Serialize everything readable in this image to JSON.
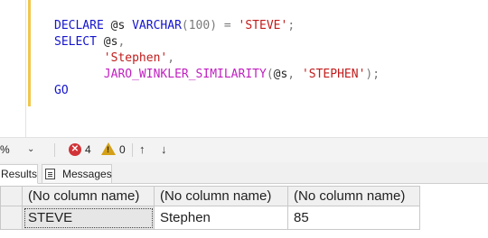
{
  "editor": {
    "lines": [
      [
        {
          "t": "DECLARE",
          "c": "kw"
        },
        {
          "t": " @s ",
          "c": "tx"
        },
        {
          "t": "VARCHAR",
          "c": "kw"
        },
        {
          "t": "(100)",
          "c": "gr"
        },
        {
          "t": " = ",
          "c": "gr"
        },
        {
          "t": "'STEVE'",
          "c": "str"
        },
        {
          "t": ";",
          "c": "gr"
        }
      ],
      [
        {
          "t": "SELECT",
          "c": "kw"
        },
        {
          "t": " @s",
          "c": "tx"
        },
        {
          "t": ",",
          "c": "gr"
        }
      ],
      [
        {
          "t": "       ",
          "c": "tx"
        },
        {
          "t": "'Stephen'",
          "c": "str"
        },
        {
          "t": ",",
          "c": "gr"
        }
      ],
      [
        {
          "t": "       ",
          "c": "tx"
        },
        {
          "t": "JARO_WINKLER_SIMILARITY",
          "c": "fn"
        },
        {
          "t": "(",
          "c": "gr"
        },
        {
          "t": "@s",
          "c": "tx"
        },
        {
          "t": ", ",
          "c": "gr"
        },
        {
          "t": "'STEPHEN'",
          "c": "str"
        },
        {
          "t": ");",
          "c": "gr"
        }
      ],
      [
        {
          "t": "GO",
          "c": "kw"
        }
      ]
    ]
  },
  "status": {
    "zoom_value": "%",
    "errors": "4",
    "warnings": "0"
  },
  "tabs": {
    "results_label": "Results",
    "messages_label": "Messages"
  },
  "grid": {
    "headers": [
      "(No column name)",
      "(No column name)",
      "(No column name)"
    ],
    "rows": [
      [
        "STEVE",
        "Stephen",
        "85"
      ]
    ]
  },
  "colors": {
    "keyword": "#1515cc",
    "string": "#c21b1b",
    "function": "#c020c0",
    "error": "#d13438",
    "warning": "#d4a017",
    "change_bar": "#f0c64a"
  },
  "icons": [
    "error-icon",
    "warning-icon",
    "up-arrow-icon",
    "down-arrow-icon",
    "messages-icon",
    "chevron-down-icon"
  ]
}
